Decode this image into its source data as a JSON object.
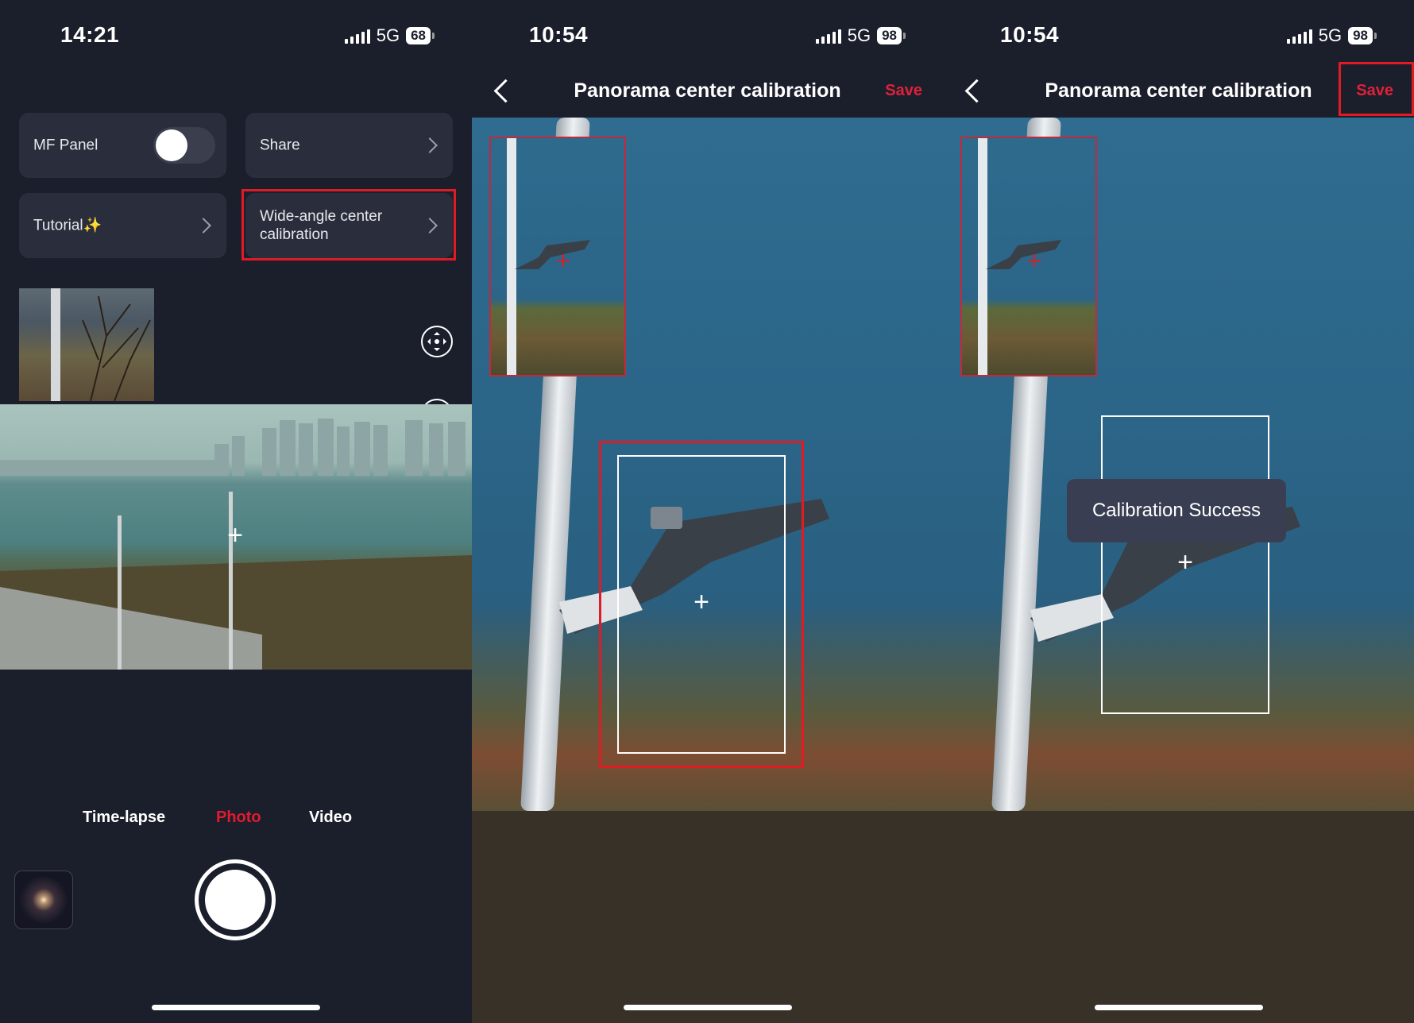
{
  "screens": [
    {
      "status": {
        "time": "14:21",
        "network": "5G",
        "battery": "68"
      },
      "tiles": {
        "mf_panel": "MF Panel",
        "share": "Share",
        "tutorial": "Tutorial",
        "tutorial_emoji": "✨",
        "wide_angle_line1": "Wide-angle center",
        "wide_angle_line2": "calibration"
      },
      "mf_panel_toggle_on": false,
      "modes": [
        "Time-lapse",
        "Photo",
        "Video"
      ],
      "active_mode": "Photo",
      "help_icon": "?",
      "crosshair": "+"
    },
    {
      "status": {
        "time": "10:54",
        "network": "5G",
        "battery": "98"
      },
      "nav": {
        "title": "Panorama center calibration",
        "save": "Save"
      },
      "crosshair": "+"
    },
    {
      "status": {
        "time": "10:54",
        "network": "5G",
        "battery": "98"
      },
      "nav": {
        "title": "Panorama center calibration",
        "save": "Save"
      },
      "toast": "Calibration Success",
      "crosshair": "+"
    }
  ],
  "colors": {
    "accent": "#e01b2f",
    "highlight": "#e01b24",
    "background": "#1b1e2b"
  }
}
